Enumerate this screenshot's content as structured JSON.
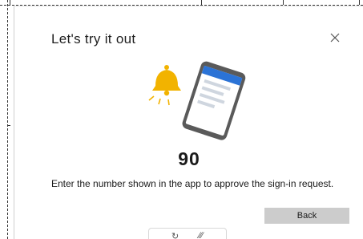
{
  "dialog": {
    "title": "Let's try it out",
    "close_icon": "close-icon",
    "illustration_icons": [
      "bell-icon",
      "phone-icon"
    ],
    "number": "90",
    "instructions": "Enter the number shown in the app to approve the sign-in request.",
    "back_label": "Back"
  },
  "colors": {
    "accent": "#2b73d6",
    "bell": "#f2b300",
    "button_bg": "#cccccc",
    "phone_frame": "#555555"
  }
}
